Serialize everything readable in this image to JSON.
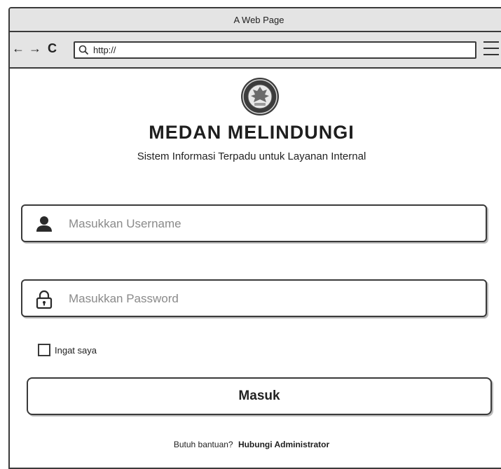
{
  "browser": {
    "window_title": "A Web Page",
    "back_glyph": "←",
    "forward_glyph": "→",
    "reload_glyph": "C",
    "url": "http://",
    "icons": [
      "search-icon",
      "menu-icon"
    ]
  },
  "app": {
    "logo_icon": "emblem-seal-icon",
    "title": "MEDAN MELINDUNGI",
    "subtitle": "Sistem Informasi Terpadu untuk Layanan Internal"
  },
  "login_form": {
    "username": {
      "icon": "user-icon",
      "placeholder": "Masukkan Username",
      "value": ""
    },
    "password": {
      "icon": "lock-icon",
      "placeholder": "Masukkan Password",
      "value": ""
    },
    "remember_me": {
      "label": "Ingat saya",
      "checked": false
    },
    "submit_label": "Masuk"
  },
  "help": {
    "prompt": "Butuh bantuan?",
    "link_text": "Hubungi Administrator"
  }
}
